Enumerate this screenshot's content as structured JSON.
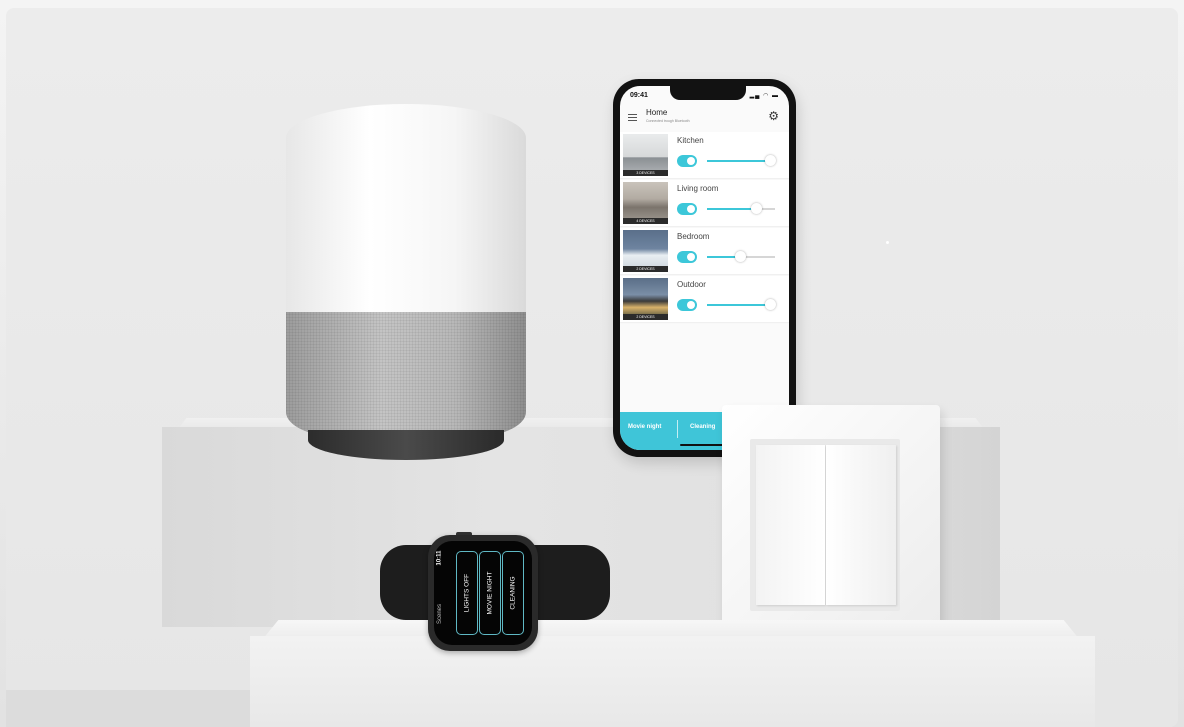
{
  "phone": {
    "status_time": "09:41",
    "home_title": "Home",
    "home_subtitle": "Connected trough Bluetooth",
    "rooms": [
      {
        "name": "Kitchen",
        "devices": "3 DEVICES",
        "brightness": 0.92
      },
      {
        "name": "Living room",
        "devices": "4 DEVICES",
        "brightness": 0.72
      },
      {
        "name": "Bedroom",
        "devices": "2 DEVICES",
        "brightness": 0.48
      },
      {
        "name": "Outdoor",
        "devices": "2 DEVICES",
        "brightness": 0.92
      }
    ],
    "scenes": [
      "Movie night",
      "Cleaning"
    ]
  },
  "watch": {
    "time": "10:11",
    "title": "Scenes",
    "buttons": [
      "LIGHTS OFF",
      "MOVIE NIGHT",
      "CLEANING"
    ]
  },
  "colors": {
    "accent": "#3fc5d8",
    "background": "#ececec"
  }
}
